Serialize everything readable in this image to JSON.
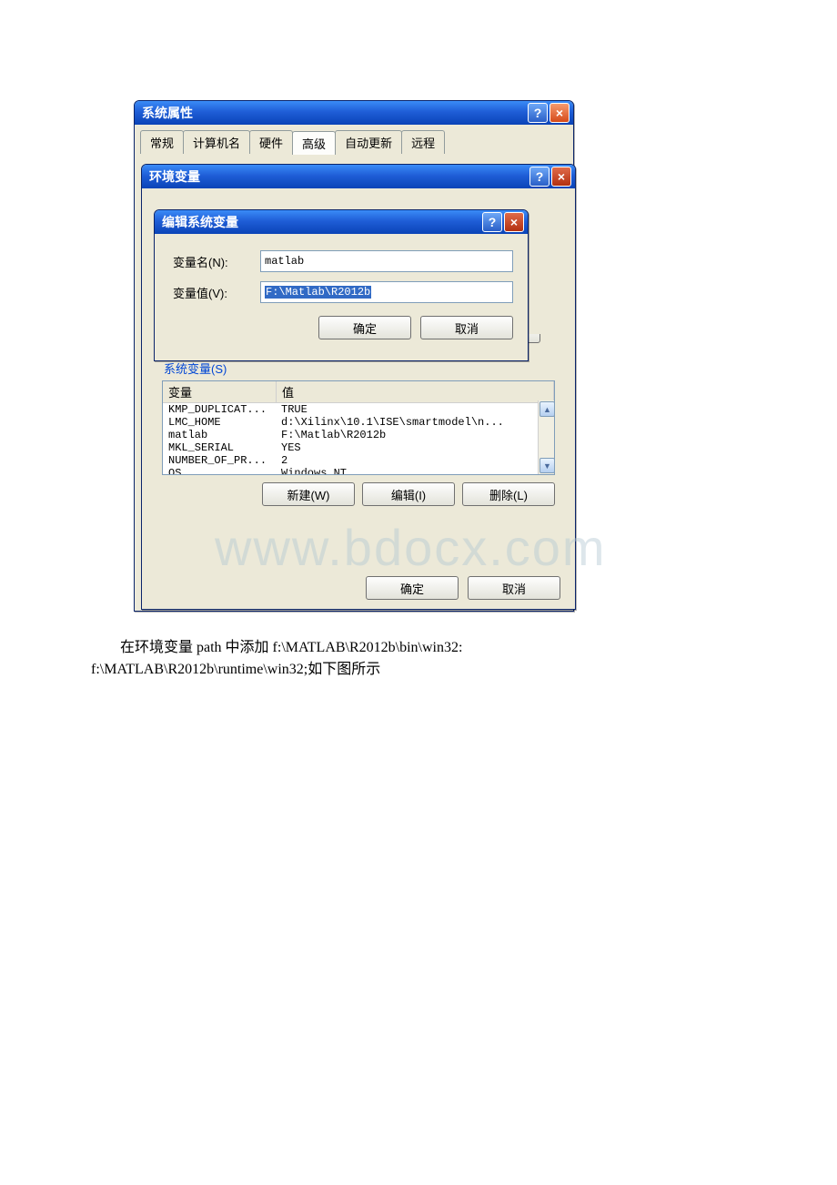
{
  "outer_window": {
    "title": "系统属性",
    "tabs": [
      "常规",
      "计算机名",
      "硬件",
      "高级",
      "自动更新",
      "远程"
    ],
    "active_tab": "高级"
  },
  "env_window": {
    "title": "环境变量"
  },
  "edit_dialog": {
    "title": "编辑系统变量",
    "name_label": "变量名(N):",
    "value_label": "变量值(V):",
    "name_value": "matlab",
    "value_value": "F:\\Matlab\\R2012b",
    "ok": "确定",
    "cancel": "取消"
  },
  "sys_vars": {
    "label": "系统变量(S)",
    "col_name": "变量",
    "col_value": "值",
    "rows": [
      {
        "name": "KMP_DUPLICAT...",
        "value": "TRUE"
      },
      {
        "name": "LMC_HOME",
        "value": "d:\\Xilinx\\10.1\\ISE\\smartmodel\\n..."
      },
      {
        "name": "matlab",
        "value": "F:\\Matlab\\R2012b"
      },
      {
        "name": "MKL_SERIAL",
        "value": "YES"
      },
      {
        "name": "NUMBER_OF_PR...",
        "value": "2"
      },
      {
        "name": "OS",
        "value": "Windows_NT"
      }
    ],
    "new_btn": "新建(W)",
    "edit_btn": "编辑(I)",
    "delete_btn": "删除(L)"
  },
  "bottom": {
    "ok": "确定",
    "cancel": "取消"
  },
  "watermark": "www.bdocx.com",
  "caption_line1": "在环境变量 path 中添加 f:\\MATLAB\\R2012b\\bin\\win32:",
  "caption_line2": "f:\\MATLAB\\R2012b\\runtime\\win32;如下图所示"
}
